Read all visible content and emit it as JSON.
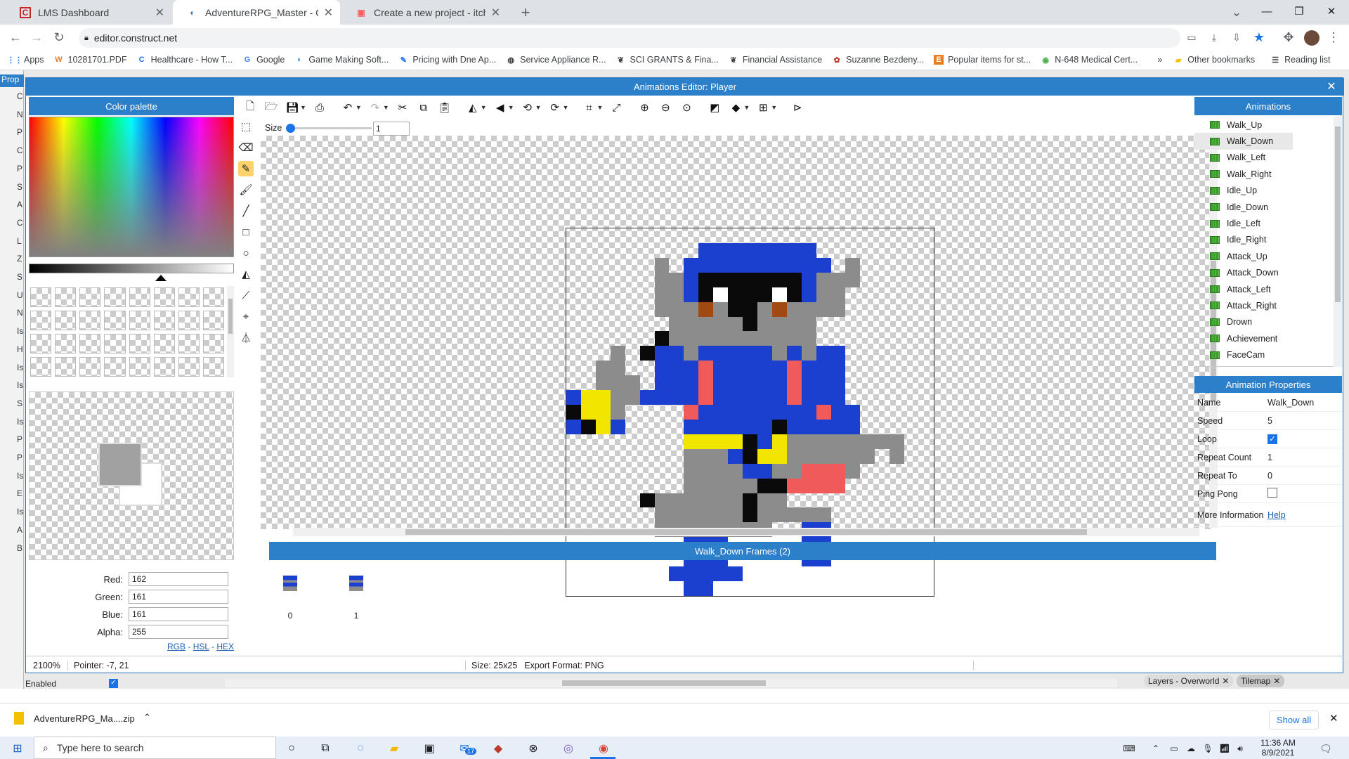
{
  "browser": {
    "tabs": [
      {
        "title": "LMS Dashboard",
        "active": false
      },
      {
        "title": "AdventureRPG_Master - Constru",
        "active": true
      },
      {
        "title": "Create a new project - itch.io",
        "active": false
      }
    ],
    "url": "editor.construct.net",
    "bookmarks": [
      "Apps",
      "10281701.PDF",
      "Healthcare - How T...",
      "Google",
      "Game Making Soft...",
      "Pricing with Dne Ap...",
      "Service Appliance R...",
      "SCI GRANTS & Fina...",
      "Financial Assistance",
      "Suzanne Bezdeny...",
      "Popular items for st...",
      "N-648 Medical Cert..."
    ],
    "bookmarks_more": "»",
    "other_bookmarks": "Other bookmarks",
    "reading_list": "Reading list"
  },
  "left_strip": {
    "items": [
      "Prop",
      "C",
      "N",
      "P",
      "C",
      "P",
      "S",
      "A",
      "C",
      "L",
      "Z",
      "S",
      "U",
      "N",
      "Is",
      "H",
      "Is",
      "Is",
      "S",
      "Is",
      "P",
      "P",
      "Is",
      "E",
      "Is",
      "A",
      "B"
    ],
    "bottom_label": "Enabled"
  },
  "dialog": {
    "title": "Animations Editor: Player",
    "color_palette": {
      "header": "Color palette",
      "red_label": "Red:",
      "red": "162",
      "green_label": "Green:",
      "green": "161",
      "blue_label": "Blue:",
      "blue": "161",
      "alpha_label": "Alpha:",
      "alpha": "255",
      "mode_rgb": "RGB",
      "mode_hsl": "HSL",
      "mode_hex": "HEX",
      "mode_sep": "-"
    },
    "size_label": "Size",
    "size_value": "1",
    "frames_header": "Walk_Down Frames (2)",
    "frames": [
      "0",
      "1"
    ],
    "status": {
      "zoom": "2100%",
      "pointer": "Pointer: -7, 21",
      "size": "Size: 25x25",
      "export": "Export Format: PNG"
    },
    "animations": {
      "header": "Animations",
      "items": [
        "Walk_Up",
        "Walk_Down",
        "Walk_Left",
        "Walk_Right",
        "Idle_Up",
        "Idle_Down",
        "Idle_Left",
        "Idle_Right",
        "Attack_Up",
        "Attack_Down",
        "Attack_Left",
        "Attack_Right",
        "Drown",
        "Achievement",
        "FaceCam"
      ],
      "selected": "Walk_Down"
    },
    "properties": {
      "header": "Animation Properties",
      "name_label": "Name",
      "name": "Walk_Down",
      "speed_label": "Speed",
      "speed": "5",
      "loop_label": "Loop",
      "loop": true,
      "repeat_count_label": "Repeat Count",
      "repeat_count": "1",
      "repeat_to_label": "Repeat To",
      "repeat_to": "0",
      "ping_pong_label": "Ping Pong",
      "ping_pong": false,
      "more_info_label": "More Information",
      "more_info_link": "Help"
    }
  },
  "bottom_tabs": {
    "layers": "Layers - Overworld",
    "tilemap": "Tilemap"
  },
  "download": {
    "file": "AdventureRPG_Ma....zip",
    "show_all": "Show all"
  },
  "taskbar": {
    "search_placeholder": "Type here to search",
    "time": "11:36 AM",
    "date": "8/9/2021",
    "mail_badge": "17"
  },
  "colors": {
    "accent": "#2c7fc9",
    "selected_tool": "#ffd26b",
    "anim_icon": "#3a9c2a"
  }
}
